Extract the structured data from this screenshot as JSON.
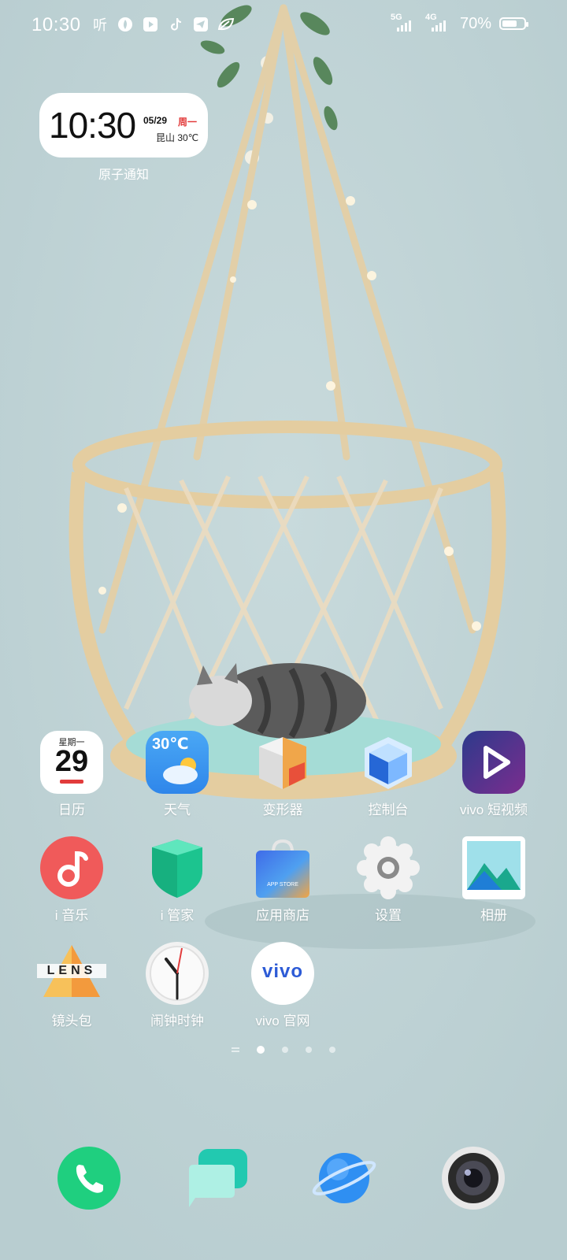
{
  "status_bar": {
    "time": "10:30",
    "left_icons": [
      "ting-icon",
      "browser-flame-icon",
      "video-play-icon",
      "tiktok-icon",
      "telegram-icon",
      "leaf-icon"
    ],
    "network_1": "5G",
    "network_2": "4G",
    "battery_percent": "70%"
  },
  "widget": {
    "time": "10:30",
    "date": "05/29",
    "weekday": "周一",
    "location_weather": "昆山 30℃",
    "caption": "原子通知"
  },
  "apps": [
    {
      "label": "日历",
      "icon": "calendar-icon",
      "weekday": "星期一",
      "day": "29"
    },
    {
      "label": "天气",
      "icon": "weather-icon",
      "temp": "30℃"
    },
    {
      "label": "变形器",
      "icon": "transformer-cube-icon"
    },
    {
      "label": "控制台",
      "icon": "console-cube-icon"
    },
    {
      "label": "vivo 短视频",
      "icon": "short-video-icon"
    },
    {
      "label": "i 音乐",
      "icon": "music-icon"
    },
    {
      "label": "i 管家",
      "icon": "security-manager-icon"
    },
    {
      "label": "应用商店",
      "icon": "app-store-icon",
      "bag_text": "APP STORE"
    },
    {
      "label": "设置",
      "icon": "settings-gear-icon"
    },
    {
      "label": "相册",
      "icon": "gallery-icon"
    },
    {
      "label": "镜头包",
      "icon": "lens-icon",
      "logo_text": "LENS"
    },
    {
      "label": "闹钟时钟",
      "icon": "clock-icon"
    },
    {
      "label": "vivo 官网",
      "icon": "vivo-site-icon",
      "logo_text": "vivo"
    }
  ],
  "page_indicator": {
    "pages": 4,
    "active_index": 0
  },
  "dock": [
    {
      "icon": "phone-icon"
    },
    {
      "icon": "messages-icon"
    },
    {
      "icon": "browser-planet-icon"
    },
    {
      "icon": "camera-icon"
    }
  ],
  "colors": {
    "background": "#bfd3d6",
    "weekday_red": "#e23b3b",
    "phone_green": "#1fcf7f",
    "music_red": "#f05a5a"
  }
}
